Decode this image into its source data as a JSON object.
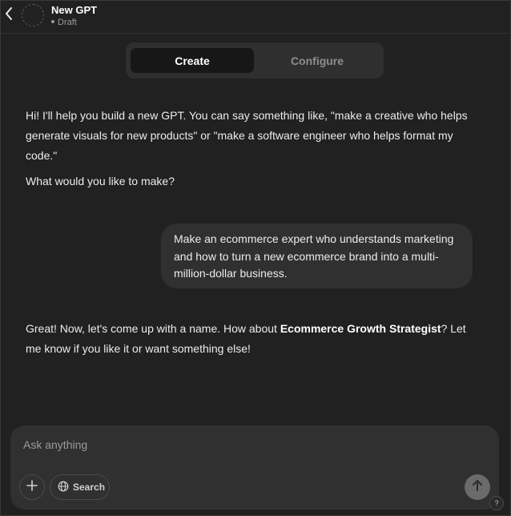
{
  "header": {
    "back_icon": "chevron-left-icon",
    "title": "New GPT",
    "status": "Draft"
  },
  "tabs": [
    {
      "label": "Create",
      "active": true
    },
    {
      "label": "Configure",
      "active": false
    }
  ],
  "messages": {
    "assistant_1": {
      "text": "Hi! I'll help you build a new GPT. You can say something like, \"make a creative who helps generate visuals for new products\" or \"make a software engineer who helps format my code.\"",
      "question": "What would you like to make?"
    },
    "user_1": {
      "text": "Make an ecommerce expert who understands marketing and how to turn a new ecommerce brand into a multi-million-dollar business."
    },
    "assistant_2": {
      "before": "Great! Now, let's come up with a name. How about ",
      "bold": "Ecommerce Growth Strategist",
      "after": "? Let me know if you like it or want something else!"
    }
  },
  "composer": {
    "placeholder": "Ask anything",
    "value": "",
    "plus_icon": "plus-icon",
    "search_label": "Search",
    "search_icon": "globe-icon",
    "send_icon": "arrow-up-icon"
  },
  "help": {
    "label": "?"
  },
  "colors": {
    "background": "#212121",
    "surface": "#303030",
    "tab_active": "#171717",
    "text": "#ececec",
    "muted": "#9b9b9b",
    "send_button": "#6b6b6b"
  }
}
